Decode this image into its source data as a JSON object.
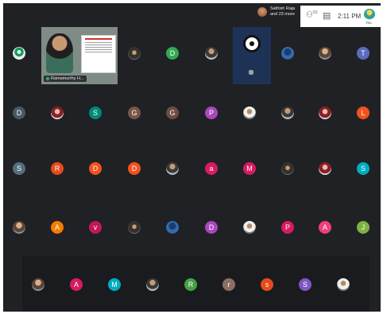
{
  "header": {
    "presenter_line1": "Sathish Raja",
    "presenter_line2": "and 23 more",
    "people_count": "63",
    "time": "2:11 PM",
    "you_label": "You"
  },
  "featured": {
    "name": "Ramamurthy H..."
  },
  "colors": {
    "background": "#202124",
    "bottom_strip": "#1a1b1e",
    "tray": "#ffffff"
  },
  "rows": [
    [
      {
        "kind": "photo",
        "style": "g"
      },
      {
        "kind": "featured"
      },
      {
        "kind": "photo",
        "style": "f"
      },
      {
        "kind": "letter",
        "letter": "D",
        "color": "#33a852"
      },
      {
        "kind": "photo",
        "style": "b"
      },
      {
        "kind": "obs"
      },
      {
        "kind": "photo",
        "style": "d"
      },
      {
        "kind": "photo",
        "style": "a"
      },
      {
        "kind": "letter",
        "letter": "T",
        "color": "#5c6bc0"
      }
    ],
    [
      {
        "kind": "letter",
        "letter": "D",
        "color": "#455a64"
      },
      {
        "kind": "photo",
        "style": "c"
      },
      {
        "kind": "letter",
        "letter": "S",
        "color": "#00897b"
      },
      {
        "kind": "letter",
        "letter": "G",
        "color": "#795548"
      },
      {
        "kind": "letter",
        "letter": "G",
        "color": "#6d4c41"
      },
      {
        "kind": "letter",
        "letter": "P",
        "color": "#ab47bc"
      },
      {
        "kind": "photo",
        "style": "e"
      },
      {
        "kind": "photo",
        "style": "b"
      },
      {
        "kind": "photo",
        "style": "c"
      },
      {
        "kind": "letter",
        "letter": "L",
        "color": "#f4511e"
      }
    ],
    [
      {
        "kind": "letter",
        "letter": "S",
        "color": "#546e7a"
      },
      {
        "kind": "letter",
        "letter": "R",
        "color": "#e64a19"
      },
      {
        "kind": "letter",
        "letter": "D",
        "color": "#f4511e"
      },
      {
        "kind": "letter",
        "letter": "D",
        "color": "#f4511e"
      },
      {
        "kind": "photo",
        "style": "b"
      },
      {
        "kind": "letter",
        "letter": "a",
        "color": "#d81b60"
      },
      {
        "kind": "letter",
        "letter": "M",
        "color": "#d81b60"
      },
      {
        "kind": "photo",
        "style": "f"
      },
      {
        "kind": "photo",
        "style": "c"
      },
      {
        "kind": "letter",
        "letter": "S",
        "color": "#00acc1"
      }
    ],
    [
      {
        "kind": "photo",
        "style": "a"
      },
      {
        "kind": "letter",
        "letter": "A",
        "color": "#f57c00"
      },
      {
        "kind": "letter",
        "letter": "v",
        "color": "#c2185b"
      },
      {
        "kind": "photo",
        "style": "f"
      },
      {
        "kind": "photo",
        "style": "d"
      },
      {
        "kind": "letter",
        "letter": "D",
        "color": "#ab47bc"
      },
      {
        "kind": "photo",
        "style": "e"
      },
      {
        "kind": "letter",
        "letter": "P",
        "color": "#d81b60"
      },
      {
        "kind": "letter",
        "letter": "A",
        "color": "#ec407a"
      },
      {
        "kind": "letter",
        "letter": "J",
        "color": "#7cb342"
      }
    ],
    [
      {
        "kind": "photo",
        "style": "a"
      },
      {
        "kind": "letter",
        "letter": "A",
        "color": "#d81b60"
      },
      {
        "kind": "letter",
        "letter": "M",
        "color": "#00acc1"
      },
      {
        "kind": "photo",
        "style": "b"
      },
      {
        "kind": "letter",
        "letter": "R",
        "color": "#43a047"
      },
      {
        "kind": "letter",
        "letter": "r",
        "color": "#8d6e63"
      },
      {
        "kind": "letter",
        "letter": "s",
        "color": "#e64a19"
      },
      {
        "kind": "letter",
        "letter": "S",
        "color": "#7e57c2"
      },
      {
        "kind": "photo",
        "style": "e"
      }
    ]
  ]
}
